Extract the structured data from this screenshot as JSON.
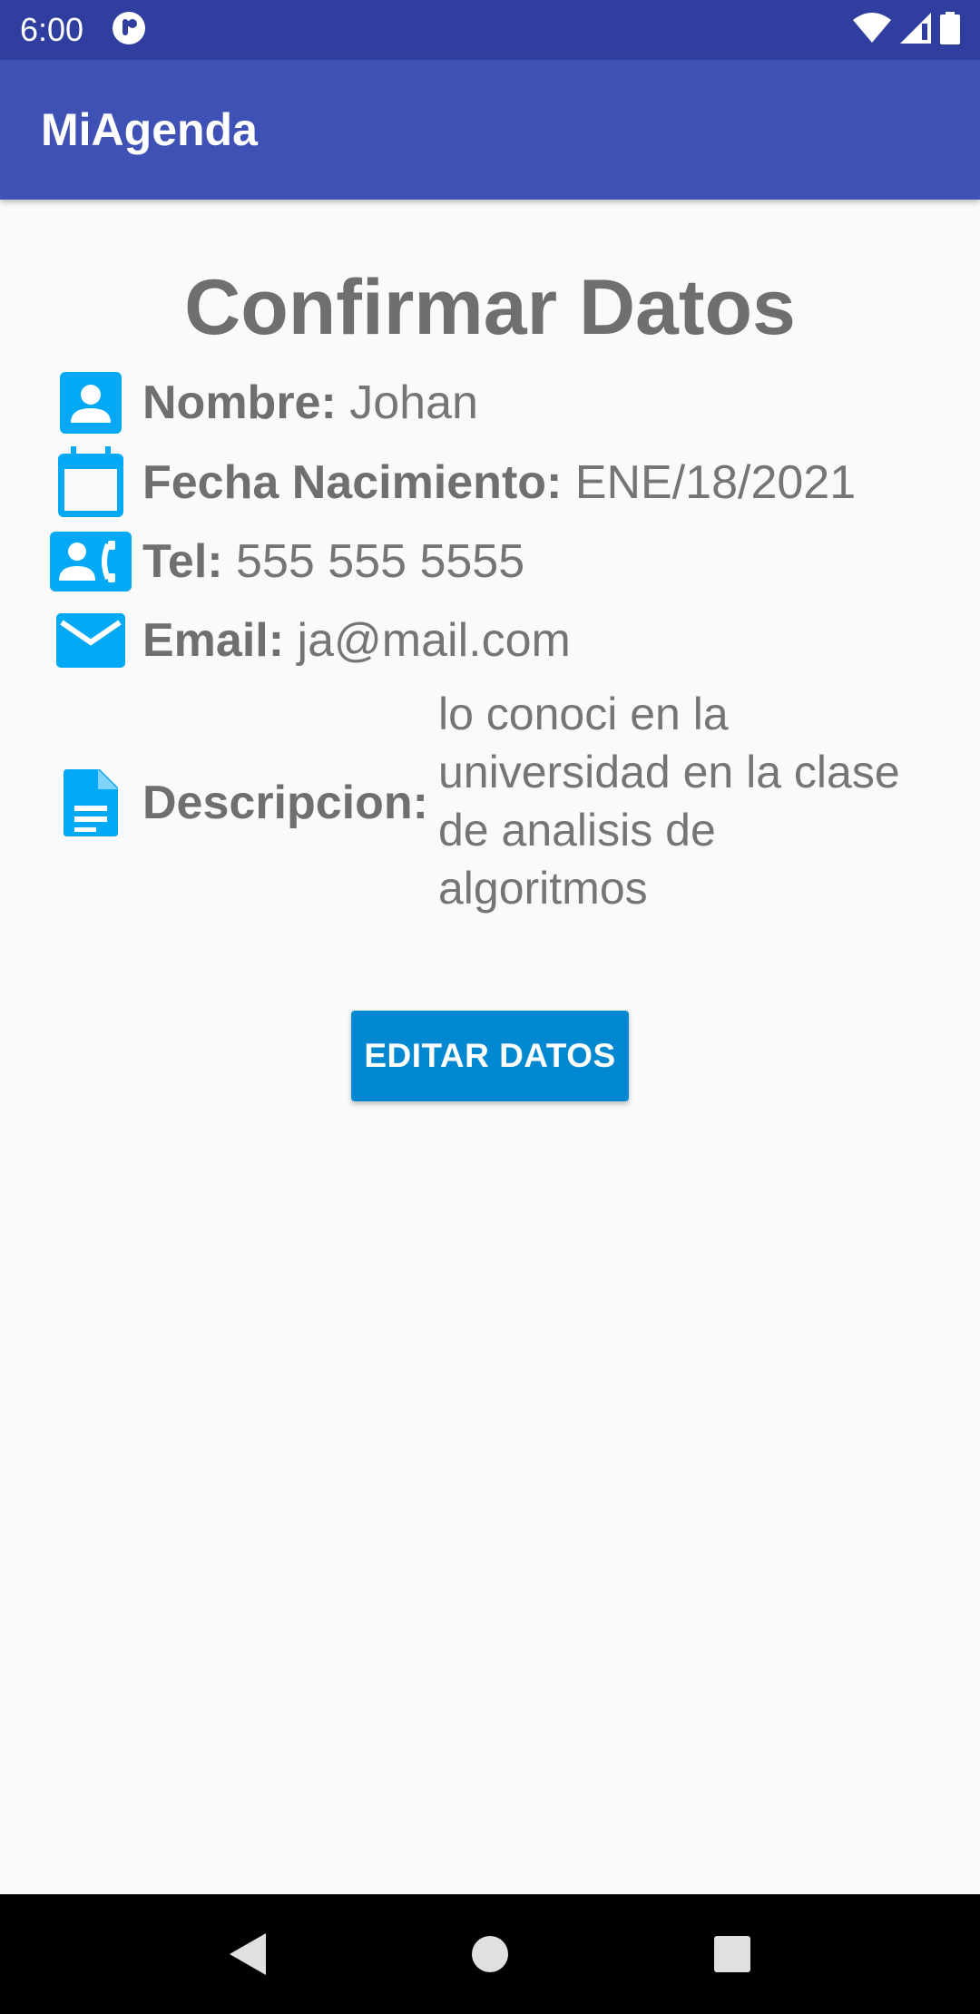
{
  "status_bar": {
    "time": "6:00",
    "icons": [
      "notification-icon",
      "wifi-icon",
      "signal-icon",
      "battery-icon"
    ]
  },
  "app_bar": {
    "title": "MiAgenda"
  },
  "page": {
    "title": "Confirmar Datos",
    "fields": [
      {
        "icon": "contact-icon",
        "label": "Nombre:",
        "value": "Johan"
      },
      {
        "icon": "calendar-icon",
        "label": "Fecha Nacimiento:",
        "value": "ENE/18/2021"
      },
      {
        "icon": "phone-contact-icon",
        "label": "Tel:",
        "value": "555 555 5555"
      },
      {
        "icon": "email-icon",
        "label": "Email:",
        "value": "ja@mail.com"
      }
    ],
    "description": {
      "icon": "document-icon",
      "label": "Descripcion:",
      "value": "lo conoci en la universidad en la clase de analisis de algoritmos"
    },
    "edit_button": "EDITAR DATOS"
  },
  "colors": {
    "status_bar": "#303f9f",
    "app_bar": "#3f51b5",
    "icon": "#03a9f4",
    "button": "#0288d1",
    "text": "#757575"
  },
  "nav_bar": {
    "icons": [
      "back-icon",
      "home-icon",
      "recents-icon"
    ]
  }
}
